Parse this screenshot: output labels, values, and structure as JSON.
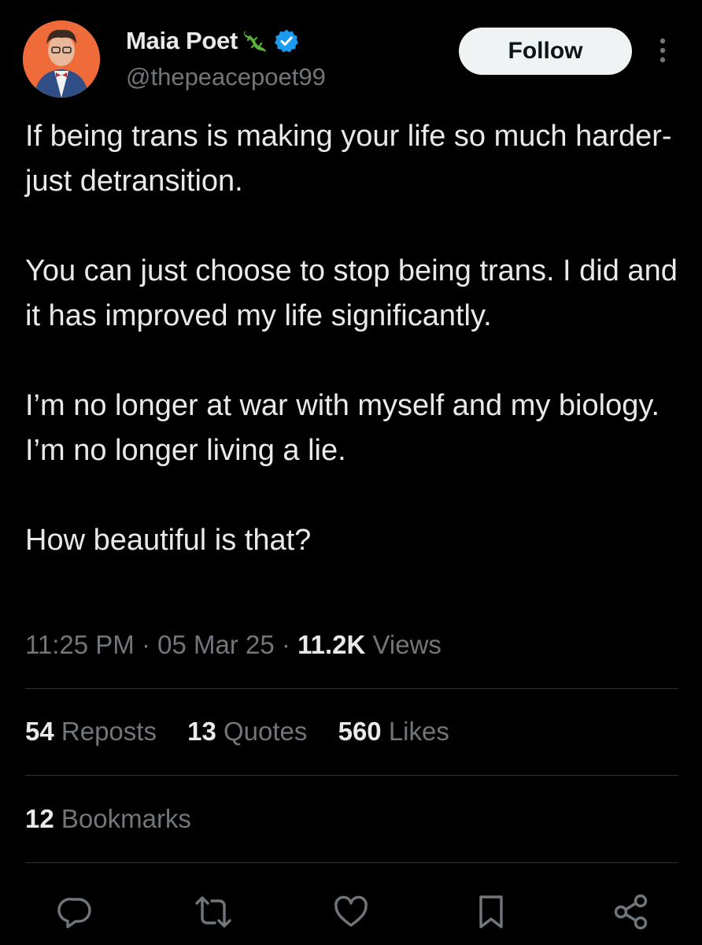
{
  "author": {
    "display_name": "Maia Poet",
    "handle": "@thepeacepoet99",
    "emoji_icon": "lizard-icon",
    "verified_icon": "verified-badge-icon",
    "avatar_bg": "#ef6b3a"
  },
  "header": {
    "follow_label": "Follow",
    "more_icon": "more-vertical-icon"
  },
  "tweet": {
    "paragraphs": [
      "If being trans is making your life so much harder- just detransition.",
      "You can just choose to stop being trans. I did and it has improved my life significantly.",
      "I’m no longer at war with myself and my biology. I’m no longer living a lie.",
      "How beautiful is that?"
    ]
  },
  "meta": {
    "time": "11:25 PM",
    "separator": " · ",
    "date": "05 Mar 25",
    "views_count": "11.2K",
    "views_label": " Views"
  },
  "stats": {
    "reposts_count": "54",
    "reposts_label": " Reposts",
    "quotes_count": "13",
    "quotes_label": " Quotes",
    "likes_count": "560",
    "likes_label": " Likes",
    "bookmarks_count": "12",
    "bookmarks_label": " Bookmarks"
  },
  "actions": [
    "reply-icon",
    "repost-icon",
    "like-icon",
    "bookmark-icon",
    "share-icon"
  ],
  "colors": {
    "background": "#000000",
    "text": "#e7e9ea",
    "secondary": "#71767b",
    "divider": "#2f3336",
    "verified": "#1d9bf0",
    "follow_bg": "#eff3f4"
  }
}
